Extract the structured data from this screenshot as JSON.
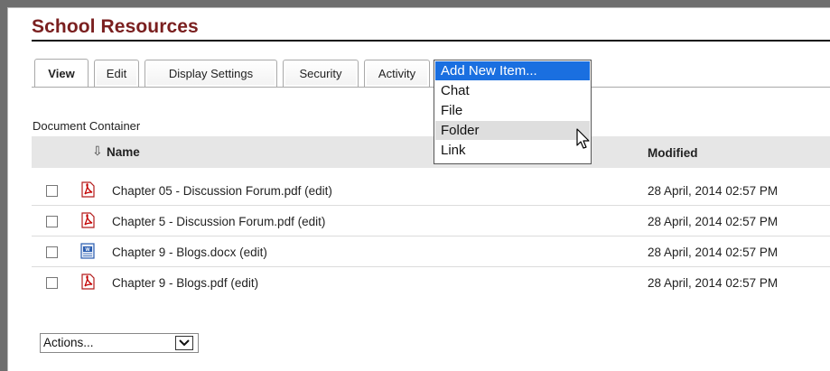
{
  "page": {
    "title": "School Resources"
  },
  "tabs": [
    {
      "label": "View"
    },
    {
      "label": "Edit"
    },
    {
      "label": "Display Settings"
    },
    {
      "label": "Security"
    },
    {
      "label": "Activity"
    }
  ],
  "add_menu": {
    "items": [
      {
        "label": "Add New Item..."
      },
      {
        "label": "Chat"
      },
      {
        "label": "File"
      },
      {
        "label": "Folder"
      },
      {
        "label": "Link"
      }
    ]
  },
  "container": {
    "label": "Document Container",
    "columns": {
      "name": "Name",
      "modified": "Modified",
      "sort_indicator": "⇩"
    },
    "rows": [
      {
        "name": "Chapter 05 - Discussion Forum.pdf (edit)",
        "modified": "28 April, 2014 02:57 PM",
        "icon": "pdf-icon"
      },
      {
        "name": "Chapter 5 - Discussion Forum.pdf (edit)",
        "modified": "28 April, 2014 02:57 PM",
        "icon": "pdf-icon"
      },
      {
        "name": "Chapter 9 - Blogs.docx (edit)",
        "modified": "28 April, 2014 02:57 PM",
        "icon": "word-doc-icon"
      },
      {
        "name": "Chapter 9 - Blogs.pdf (edit)",
        "modified": "28 April, 2014 02:57 PM",
        "icon": "pdf-icon"
      }
    ]
  },
  "actions": {
    "selected": "Actions..."
  },
  "colors": {
    "title": "#7a1f1f",
    "selection": "#1a6fe0",
    "header_bg": "#e6e6e6"
  }
}
